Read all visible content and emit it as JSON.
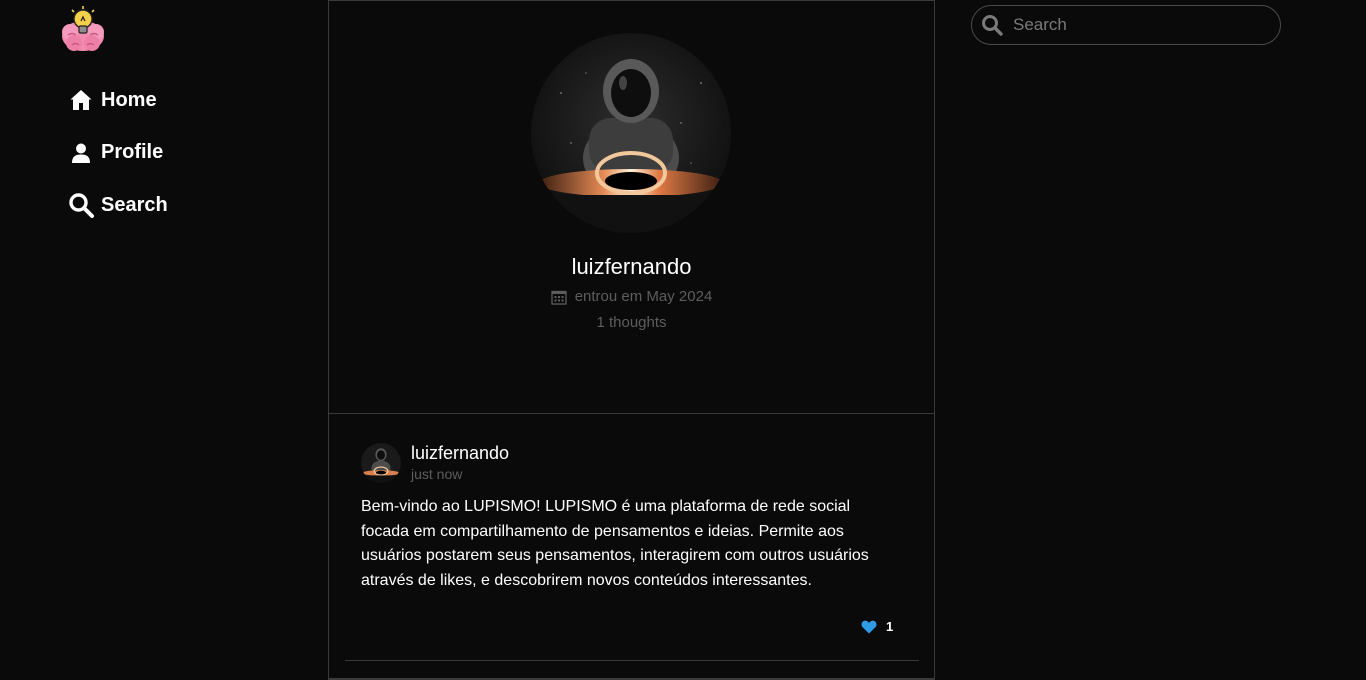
{
  "nav": {
    "items": [
      {
        "label": "Home",
        "icon": "home-icon"
      },
      {
        "label": "Profile",
        "icon": "user-icon"
      },
      {
        "label": "Search",
        "icon": "search-icon"
      }
    ]
  },
  "profile": {
    "username": "luizfernando",
    "joined": "entrou em May 2024",
    "thoughts": "1 thoughts",
    "avatar_icon": "astronaut-black-hole-avatar"
  },
  "post": {
    "username": "luizfernando",
    "time": "just now",
    "text": "Bem-vindo ao LUPISMO! LUPISMO é uma plataforma de rede social focada em compartilhamento de pensamentos e ideias. Permite aos usuários postarem seus pensamentos, interagirem com outros usuários através de likes, e descobrirem novos conteúdos interessantes.",
    "likes": "1"
  },
  "search": {
    "placeholder": "Search"
  },
  "colors": {
    "background": "#0a0a0a",
    "border": "#3a3a3a",
    "muted_text": "#5d5d5d",
    "like_blue": "#2f9be6",
    "logo_pink": "#f28bb0",
    "logo_bulb": "#f5d04a"
  }
}
